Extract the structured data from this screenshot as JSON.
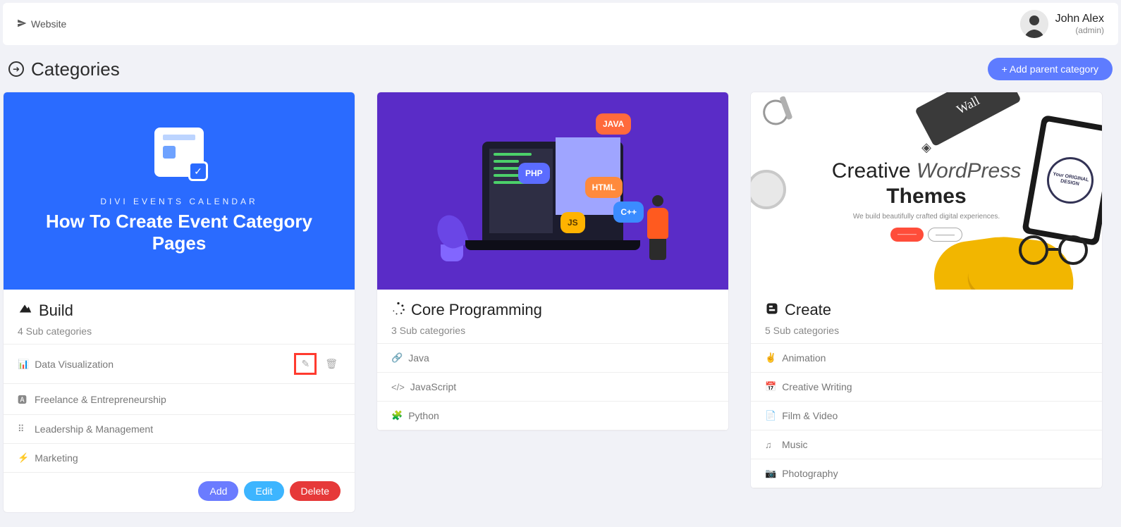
{
  "topbar": {
    "website_label": "Website",
    "user_name": "John Alex",
    "user_role": "(admin)"
  },
  "page": {
    "title": "Categories",
    "add_parent_label": "+ Add parent category"
  },
  "cards": [
    {
      "title": "Build",
      "subcount_label": "4 Sub categories",
      "image": {
        "supertitle": "DIVI EVENTS CALENDAR",
        "headline": "How To Create Event Category Pages"
      },
      "subs": [
        {
          "icon": "chart",
          "label": "Data Visualization",
          "show_actions": true
        },
        {
          "icon": "ad",
          "label": "Freelance & Entrepreneurship",
          "show_actions": false
        },
        {
          "icon": "grid",
          "label": "Leadership & Management",
          "show_actions": false
        },
        {
          "icon": "bolt",
          "label": "Marketing",
          "show_actions": false
        }
      ],
      "actions": {
        "add": "Add",
        "edit": "Edit",
        "delete": "Delete"
      }
    },
    {
      "title": "Core Programming",
      "subcount_label": "3 Sub categories",
      "image": {
        "tags": {
          "java": "JAVA",
          "php": "PHP",
          "html": "HTML",
          "js": "JS",
          "cpp": "C++"
        }
      },
      "subs": [
        {
          "icon": "link",
          "label": "Java"
        },
        {
          "icon": "code",
          "label": "JavaScript"
        },
        {
          "icon": "puzzle",
          "label": "Python"
        }
      ]
    },
    {
      "title": "Create",
      "subcount_label": "5 Sub categories",
      "image": {
        "line1a": "Creative ",
        "line1b": "WordPress",
        "line2": "Themes",
        "tagline": "We build beautifully crafted digital experiences.",
        "wallet": "Wall",
        "badge": "Your ORIGINAL DESIGN"
      },
      "subs": [
        {
          "icon": "peace",
          "label": "Animation"
        },
        {
          "icon": "calendar",
          "label": "Creative Writing"
        },
        {
          "icon": "file",
          "label": "Film & Video"
        },
        {
          "icon": "music",
          "label": "Music"
        },
        {
          "icon": "camera",
          "label": "Photography"
        }
      ]
    }
  ],
  "icons": {
    "chart": "📊",
    "ad": "🅰",
    "grid": "⠿",
    "bolt": "⚡",
    "link": "🔗",
    "code": "</>",
    "puzzle": "🧩",
    "peace": "✌",
    "calendar": "📅",
    "file": "📄",
    "music": "♫",
    "camera": "📷",
    "pencil": "✎",
    "trash": "🗑"
  }
}
